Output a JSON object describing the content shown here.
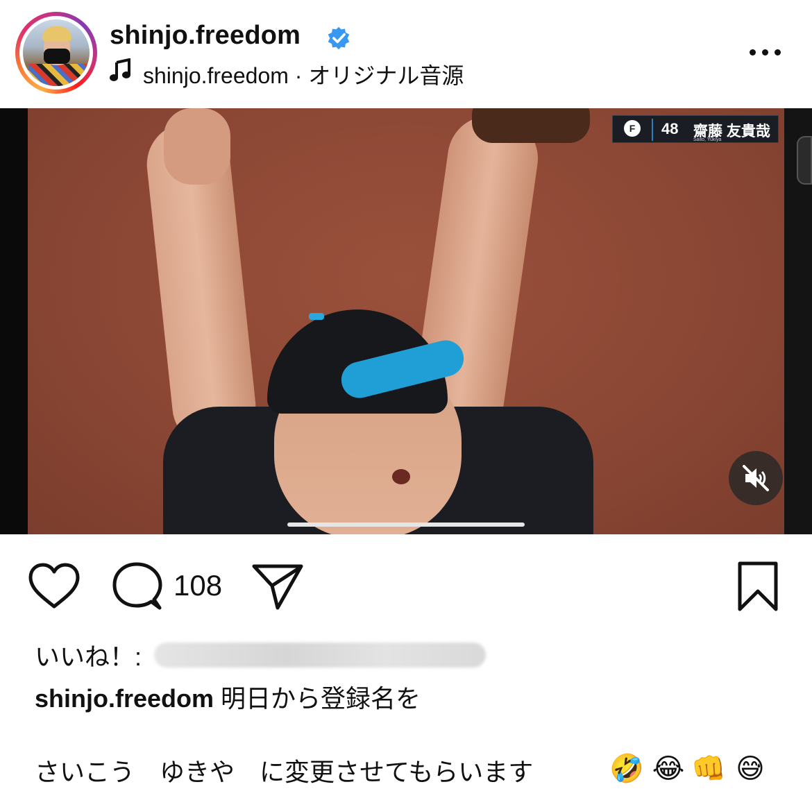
{
  "header": {
    "username": "shinjo.freedom",
    "audio_label": "shinjo.freedom · オリジナル音源",
    "verified_color": "#3897f0",
    "ring_colors": [
      "#fcaf45",
      "#e1306c",
      "#833ab4"
    ]
  },
  "media": {
    "scoreboard": {
      "team_logo": "F",
      "number": "48",
      "player_name": "齋藤 友貴哉",
      "romanized": "Saito, Yukiya"
    },
    "muted": true,
    "progress_fraction": 0.25
  },
  "actions": {
    "comment_count": "108",
    "icons": [
      "heart-icon",
      "comment-icon",
      "send-icon",
      "bookmark-icon"
    ]
  },
  "caption": {
    "likes_prefix": "いいね！:",
    "username": "shinjo.freedom",
    "line1": " 明日から登録名を",
    "line2": "さいこう　ゆきや　に変更させてもらいます　",
    "emojis": [
      "🤣",
      "😂",
      "👊",
      "😅"
    ]
  }
}
